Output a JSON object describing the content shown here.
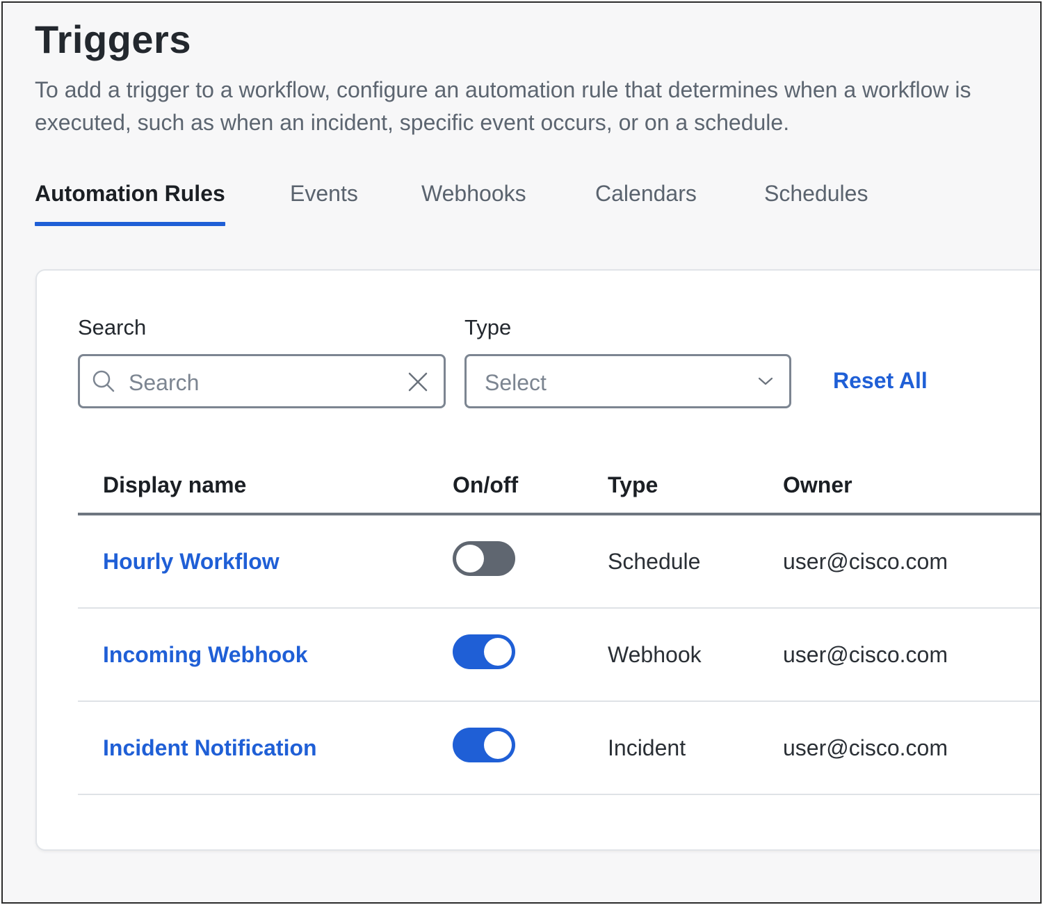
{
  "page": {
    "title": "Triggers",
    "description": "To add a trigger to a workflow, configure an automation rule that determines when a workflow is executed, such as when an incident, specific event occurs, or on a schedule."
  },
  "tabs": [
    {
      "label": "Automation Rules",
      "active": true
    },
    {
      "label": "Events",
      "active": false
    },
    {
      "label": "Webhooks",
      "active": false
    },
    {
      "label": "Calendars",
      "active": false
    },
    {
      "label": "Schedules",
      "active": false
    }
  ],
  "filters": {
    "search_label": "Search",
    "search_placeholder": "Search",
    "type_label": "Type",
    "type_placeholder": "Select",
    "reset_label": "Reset All"
  },
  "table": {
    "headers": {
      "display_name": "Display name",
      "on_off": "On/off",
      "type": "Type",
      "owner": "Owner"
    },
    "rows": [
      {
        "display_name": "Hourly Workflow",
        "enabled": false,
        "type": "Schedule",
        "owner": "user@cisco.com"
      },
      {
        "display_name": "Incoming Webhook",
        "enabled": true,
        "type": "Webhook",
        "owner": "user@cisco.com"
      },
      {
        "display_name": "Incident Notification",
        "enabled": true,
        "type": "Incident",
        "owner": "user@cisco.com"
      }
    ]
  },
  "colors": {
    "accent": "#1f5fd6",
    "toggle_off": "#5f6670",
    "text": "#23282e",
    "muted": "#5c6570"
  },
  "icons": {
    "search": "search-icon",
    "clear": "close-icon",
    "dropdown": "chevron-down-icon"
  }
}
